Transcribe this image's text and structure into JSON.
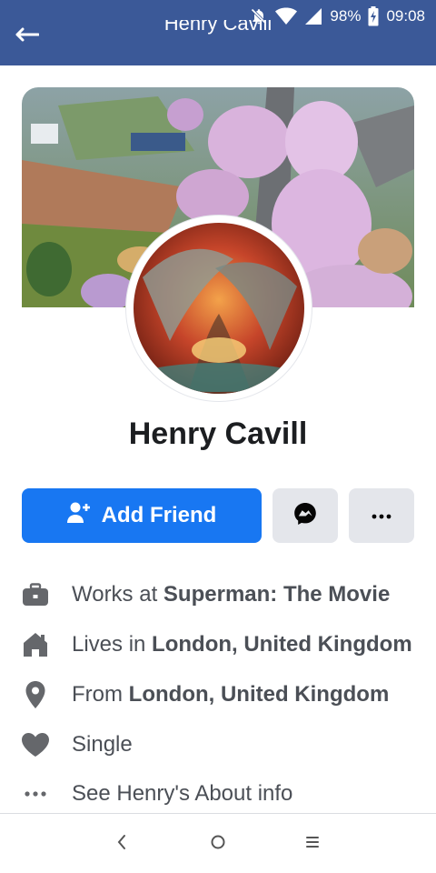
{
  "status_bar": {
    "battery": "98%",
    "time": "09:08",
    "icons": [
      "bell-muted-icon",
      "wifi-icon",
      "signal-icon",
      "battery-charging-icon"
    ]
  },
  "header": {
    "title": "Henry Cavill",
    "back_icon": "arrow-left-icon",
    "background": "#3b5998"
  },
  "profile": {
    "name": "Henry Cavill",
    "cover_image": "cherry-blossom-road-aerial",
    "avatar_image": "autumn-tree-tunnel"
  },
  "actions": {
    "add_friend_label": "Add Friend",
    "add_friend_icon": "add-person-icon",
    "message_icon": "messenger-icon",
    "more_icon": "more-dots-icon",
    "primary_color": "#1877f2"
  },
  "about": {
    "work_prefix": "Works at ",
    "work_value": "Superman: The Movie",
    "lives_prefix": "Lives in ",
    "lives_value": "London, United Kingdom",
    "from_prefix": "From ",
    "from_value": "London, United Kingdom",
    "relationship": "Single",
    "see_more": "See Henry's About info"
  },
  "nav": {
    "back_icon": "nav-back-icon",
    "home_icon": "nav-home-icon",
    "menu_icon": "nav-menu-icon"
  }
}
